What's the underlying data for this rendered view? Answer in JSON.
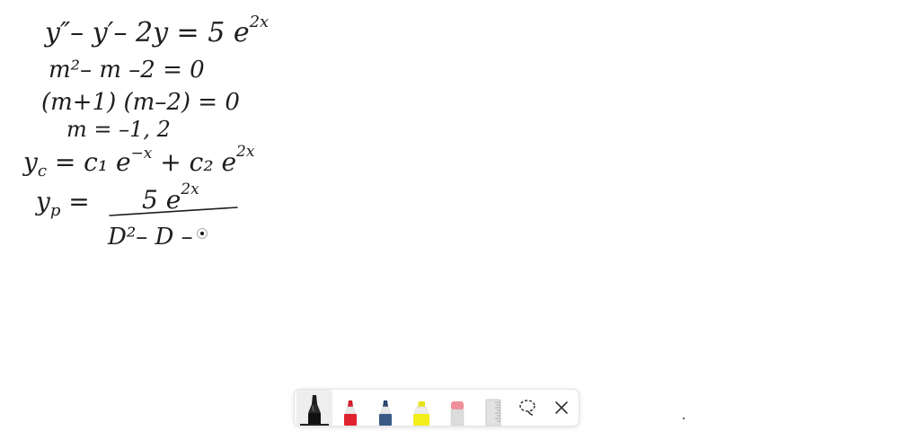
{
  "canvas": {
    "lines": [
      {
        "main": "y″– y′– 2y  = 5 e",
        "sup": "2x"
      },
      {
        "main": "m²– m –2  = 0"
      },
      {
        "main": "(m+1) (m–2)   = 0"
      },
      {
        "main": "m = –1, 2"
      },
      {
        "main": "y",
        "sub": "c",
        "rest": " =  c₁ e",
        "sup1": "−x",
        "rest2": " + c₂ e",
        "sup2": "2x"
      },
      {
        "main": "y",
        "sub": "p",
        "rest": "  ="
      }
    ],
    "fraction": {
      "numerator": "5 e",
      "numerator_sup": "2x",
      "denominator": "D²– D –"
    }
  },
  "toolbar": {
    "tools": [
      {
        "name": "black-marker",
        "color": "#1a1a1a",
        "active": true
      },
      {
        "name": "red-marker",
        "color": "#e0232f",
        "active": false
      },
      {
        "name": "blue-marker",
        "color": "#3b5a86",
        "active": false
      },
      {
        "name": "yellow-highlighter",
        "color": "#f2ee1c",
        "active": false
      },
      {
        "name": "eraser",
        "color": "#f08d9a",
        "active": false
      },
      {
        "name": "ruler",
        "color": "#bdbdbd",
        "active": false
      }
    ],
    "lasso_icon": "lasso-icon",
    "close_icon": "close-icon"
  }
}
